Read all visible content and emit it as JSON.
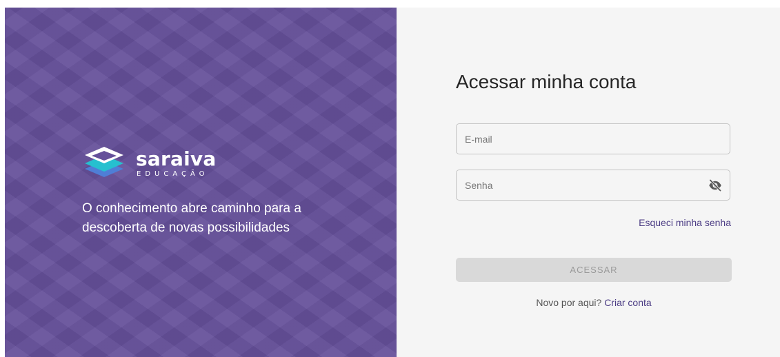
{
  "brand": {
    "name": "saraiva",
    "subtitle": "EDUCAÇÃO",
    "tagline": "O conhecimento abre caminho para a descoberta de novas possibilidades",
    "background_color": "#65509a",
    "logo_colors": [
      "#ffffff",
      "#26c0cf",
      "#4f7ed6"
    ]
  },
  "login": {
    "title": "Acessar minha conta",
    "email_placeholder": "E-mail",
    "password_placeholder": "Senha",
    "toggle_icon": "eye-off-icon",
    "forgot_password": "Esqueci minha senha",
    "submit_label": "ACESSAR",
    "signup_prompt": "Novo por aqui?",
    "signup_link": "Criar conta",
    "accent_color": "#4b3c84"
  }
}
